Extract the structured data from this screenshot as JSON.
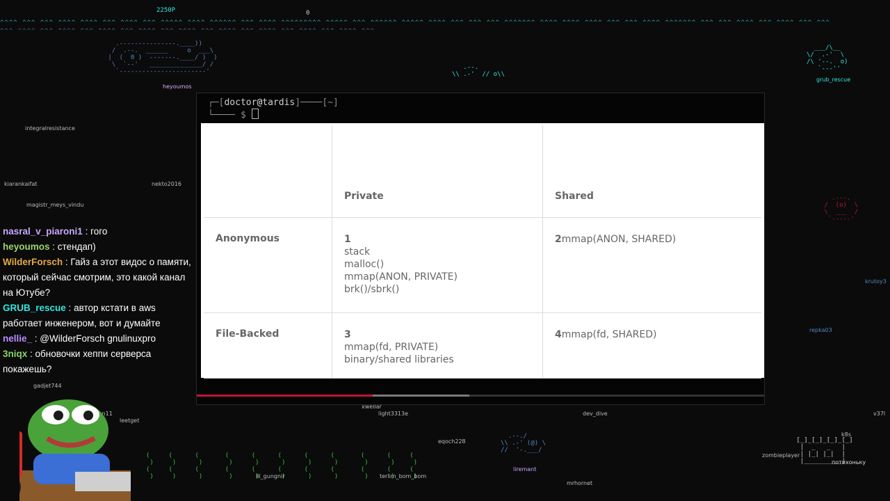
{
  "terminal": {
    "user": "doctor",
    "host": "tardis",
    "path": "~",
    "prompt_symbol": "$"
  },
  "table": {
    "headers": [
      "",
      "Private",
      "Shared"
    ],
    "rows": [
      {
        "label": "Anonymous",
        "private": {
          "num": "1",
          "lines": [
            "stack",
            "malloc()",
            "mmap(ANON, PRIVATE)",
            "brk()/sbrk()"
          ]
        },
        "shared": {
          "num": "2",
          "text": "mmap(ANON, SHARED)"
        }
      },
      {
        "label": "File-Backed",
        "private": {
          "num": "3",
          "lines": [
            "mmap(fd, PRIVATE)",
            "binary/shared libraries"
          ]
        },
        "shared": {
          "num": "4",
          "text": "mmap(fd, SHARED)"
        }
      }
    ]
  },
  "video": {
    "progress_fraction": 0.31,
    "buffer_fraction": 0.48
  },
  "chat": [
    {
      "user": "nasral_v_piaroni1",
      "text": "гого",
      "color": "#c9a6ff"
    },
    {
      "user": "heyoumos",
      "text": "стендап)",
      "color": "#9bd36b"
    },
    {
      "user": "WilderForsch",
      "text": "Гайз а этот видос о памяти, который сейчас смотрим, это какой канал на Ютубе?",
      "color": "#e3a84a"
    },
    {
      "user": "GRUB_rescue",
      "text": "автор кстати в aws работает инженером, вот и думайте",
      "color": "#33e6e0"
    },
    {
      "user": "nellie_",
      "text": "@WilderForsch gnulinuxpro",
      "color": "#b88cff"
    },
    {
      "user": "3niqx",
      "text": "обновочки хеппи серверса покажешь?",
      "color": "#8ad16a"
    }
  ],
  "nicks": [
    {
      "name": "heyoumos",
      "color": "#d8b0ff"
    },
    {
      "name": "integralresistance",
      "color": "#bbbbbb"
    },
    {
      "name": "kiarankaifat",
      "color": "#bbbbbb"
    },
    {
      "name": "nekto2016",
      "color": "#bbbbbb"
    },
    {
      "name": "magistr_meys_vindu",
      "color": "#bbbbbb"
    },
    {
      "name": "grub_rescue",
      "color": "#33e6e0"
    },
    {
      "name": "gadjet744",
      "color": "#bbbbbb"
    },
    {
      "name": "leetget",
      "color": "#bbbbbb"
    },
    {
      "name": "xwellar",
      "color": "#bbbbbb"
    },
    {
      "name": "light3313e",
      "color": "#bbbbbb"
    },
    {
      "name": "eqoch228",
      "color": "#bbbbbb"
    },
    {
      "name": "dev_dive",
      "color": "#bbbbbb"
    },
    {
      "name": "terlim_bom_bom",
      "color": "#bbbbbb"
    },
    {
      "name": "liremant",
      "color": "#c9a6ff"
    },
    {
      "name": "mrhornet",
      "color": "#bbbbbb"
    },
    {
      "name": "lil_gungnir",
      "color": "#bbbbbb"
    },
    {
      "name": "repka03",
      "color": "#5a86c4"
    },
    {
      "name": "krutoy3",
      "color": "#5a86c4"
    },
    {
      "name": "zombieplayer",
      "color": "#bbbbbb"
    },
    {
      "name": "k8s",
      "color": "#bbbbbb"
    },
    {
      "name": "v37l",
      "color": "#bbbbbb"
    },
    {
      "name": "afon11",
      "color": "#bbbbbb"
    }
  ],
  "top_counter": "2250P",
  "overlay_extra": "потихоньку"
}
